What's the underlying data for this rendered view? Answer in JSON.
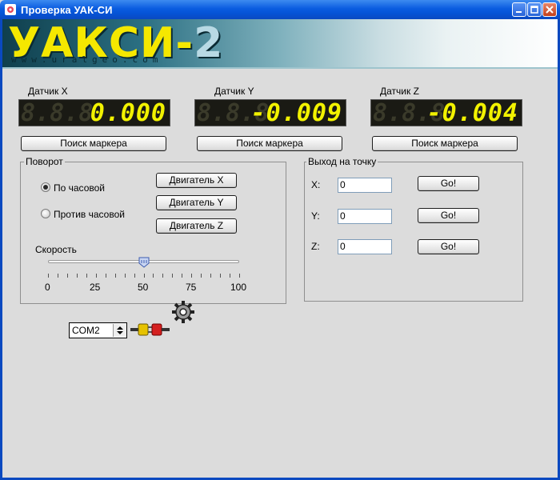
{
  "window": {
    "title": "Проверка УАК-СИ",
    "accent": "#0a5ce0"
  },
  "banner": {
    "logo_main": "УАКСИ-",
    "logo_num": "2",
    "url": "www.uralgeo.com"
  },
  "sensors": [
    {
      "label": "Датчик X",
      "ghost": "8.8.8",
      "value": "0.000",
      "button": "Поиск маркера"
    },
    {
      "label": "Датчик Y",
      "ghost": "8.8.8",
      "value": "-0.009",
      "button": "Поиск маркера"
    },
    {
      "label": "Датчик Z",
      "ghost": "8.8.8",
      "value": "-0.004",
      "button": "Поиск маркера"
    }
  ],
  "rotation": {
    "title": "Поворот",
    "options": [
      {
        "label": "По часовой",
        "checked": true
      },
      {
        "label": "Против часовой",
        "checked": false
      }
    ],
    "motor_buttons": [
      "Двигатель X",
      "Двигатель Y",
      "Двигатель Z"
    ],
    "speed_label": "Скорость",
    "speed_value": 50,
    "speed_ticks": [
      "0",
      "25",
      "50",
      "75",
      "100"
    ]
  },
  "goto": {
    "title": "Выход на точку",
    "rows": [
      {
        "label": "X:",
        "value": "0",
        "button": "Go!"
      },
      {
        "label": "Y:",
        "value": "0",
        "button": "Go!"
      },
      {
        "label": "Z:",
        "value": "0",
        "button": "Go!"
      }
    ]
  },
  "port": {
    "selected": "COM2",
    "icons": [
      "gear-icon",
      "plug-icon"
    ]
  }
}
